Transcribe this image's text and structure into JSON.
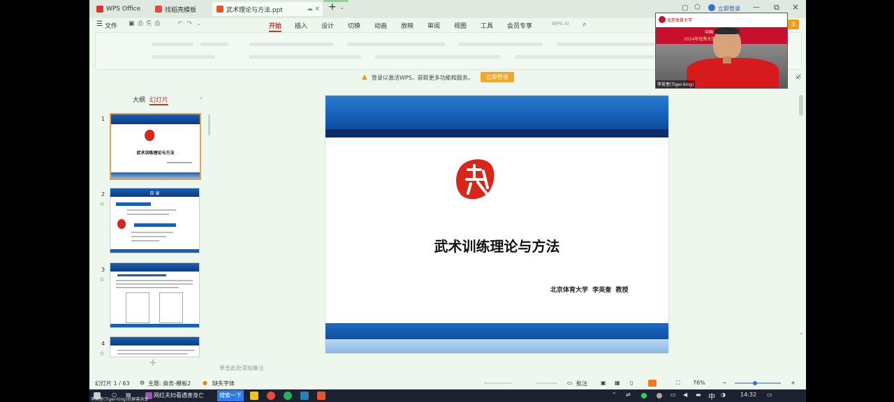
{
  "window": {
    "tabs": [
      {
        "label": "WPS Office"
      },
      {
        "label": "找稻壳模板"
      },
      {
        "label": "武术理论与方法.ppt"
      }
    ],
    "login_label": "立即登录"
  },
  "menu": {
    "file": "文件",
    "items": [
      "开始",
      "插入",
      "设计",
      "切换",
      "动画",
      "放映",
      "审阅",
      "视图",
      "工具",
      "会员专享"
    ],
    "wps_ai": "WPS AI"
  },
  "notice": {
    "text": "登录以激活WPS，获取更多功能和服务。",
    "button": "立即登录"
  },
  "panel": {
    "tab_outline": "大纲",
    "tab_slides": "幻灯片",
    "slide_numbers": [
      "1",
      "2",
      "3",
      "4"
    ],
    "thumb1_title": "武术训练理论与方法",
    "thumb2_header": "目  录"
  },
  "slide": {
    "title": "武术训练理论与方法",
    "subtitle": "北京体育大学  李英奎  教授",
    "seal_char": "武"
  },
  "notes_hint": "单击此处添加备注",
  "status": {
    "slide_count": "幻灯片 1 / 63",
    "theme": "主题: 商务-模板2",
    "missing_font": "缺失字体",
    "comment": "批注",
    "zoom": "76%"
  },
  "taskbar": {
    "search": "搜索一下",
    "ime": "中",
    "time": "14:32",
    "news": "网红夫妇看遇害身亡"
  },
  "video": {
    "caption": "李英奎(Tiger-king)",
    "banner_line1": "中国",
    "banner_line2": "2024年优秀大学生夏令营",
    "uni": "北京体育大学"
  },
  "window_label": "李英奎(Tiger-king)的屏幕共享"
}
